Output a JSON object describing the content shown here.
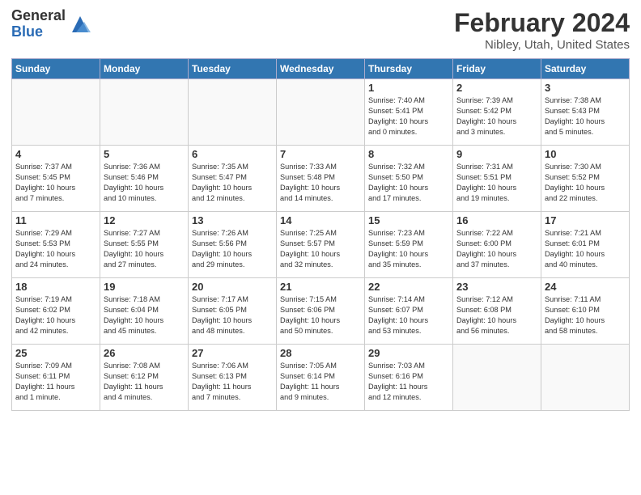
{
  "header": {
    "logo_general": "General",
    "logo_blue": "Blue",
    "main_title": "February 2024",
    "sub_title": "Nibley, Utah, United States"
  },
  "days_of_week": [
    "Sunday",
    "Monday",
    "Tuesday",
    "Wednesday",
    "Thursday",
    "Friday",
    "Saturday"
  ],
  "weeks": [
    {
      "days": [
        {
          "num": "",
          "info": ""
        },
        {
          "num": "",
          "info": ""
        },
        {
          "num": "",
          "info": ""
        },
        {
          "num": "",
          "info": ""
        },
        {
          "num": "1",
          "info": "Sunrise: 7:40 AM\nSunset: 5:41 PM\nDaylight: 10 hours\nand 0 minutes."
        },
        {
          "num": "2",
          "info": "Sunrise: 7:39 AM\nSunset: 5:42 PM\nDaylight: 10 hours\nand 3 minutes."
        },
        {
          "num": "3",
          "info": "Sunrise: 7:38 AM\nSunset: 5:43 PM\nDaylight: 10 hours\nand 5 minutes."
        }
      ]
    },
    {
      "days": [
        {
          "num": "4",
          "info": "Sunrise: 7:37 AM\nSunset: 5:45 PM\nDaylight: 10 hours\nand 7 minutes."
        },
        {
          "num": "5",
          "info": "Sunrise: 7:36 AM\nSunset: 5:46 PM\nDaylight: 10 hours\nand 10 minutes."
        },
        {
          "num": "6",
          "info": "Sunrise: 7:35 AM\nSunset: 5:47 PM\nDaylight: 10 hours\nand 12 minutes."
        },
        {
          "num": "7",
          "info": "Sunrise: 7:33 AM\nSunset: 5:48 PM\nDaylight: 10 hours\nand 14 minutes."
        },
        {
          "num": "8",
          "info": "Sunrise: 7:32 AM\nSunset: 5:50 PM\nDaylight: 10 hours\nand 17 minutes."
        },
        {
          "num": "9",
          "info": "Sunrise: 7:31 AM\nSunset: 5:51 PM\nDaylight: 10 hours\nand 19 minutes."
        },
        {
          "num": "10",
          "info": "Sunrise: 7:30 AM\nSunset: 5:52 PM\nDaylight: 10 hours\nand 22 minutes."
        }
      ]
    },
    {
      "days": [
        {
          "num": "11",
          "info": "Sunrise: 7:29 AM\nSunset: 5:53 PM\nDaylight: 10 hours\nand 24 minutes."
        },
        {
          "num": "12",
          "info": "Sunrise: 7:27 AM\nSunset: 5:55 PM\nDaylight: 10 hours\nand 27 minutes."
        },
        {
          "num": "13",
          "info": "Sunrise: 7:26 AM\nSunset: 5:56 PM\nDaylight: 10 hours\nand 29 minutes."
        },
        {
          "num": "14",
          "info": "Sunrise: 7:25 AM\nSunset: 5:57 PM\nDaylight: 10 hours\nand 32 minutes."
        },
        {
          "num": "15",
          "info": "Sunrise: 7:23 AM\nSunset: 5:59 PM\nDaylight: 10 hours\nand 35 minutes."
        },
        {
          "num": "16",
          "info": "Sunrise: 7:22 AM\nSunset: 6:00 PM\nDaylight: 10 hours\nand 37 minutes."
        },
        {
          "num": "17",
          "info": "Sunrise: 7:21 AM\nSunset: 6:01 PM\nDaylight: 10 hours\nand 40 minutes."
        }
      ]
    },
    {
      "days": [
        {
          "num": "18",
          "info": "Sunrise: 7:19 AM\nSunset: 6:02 PM\nDaylight: 10 hours\nand 42 minutes."
        },
        {
          "num": "19",
          "info": "Sunrise: 7:18 AM\nSunset: 6:04 PM\nDaylight: 10 hours\nand 45 minutes."
        },
        {
          "num": "20",
          "info": "Sunrise: 7:17 AM\nSunset: 6:05 PM\nDaylight: 10 hours\nand 48 minutes."
        },
        {
          "num": "21",
          "info": "Sunrise: 7:15 AM\nSunset: 6:06 PM\nDaylight: 10 hours\nand 50 minutes."
        },
        {
          "num": "22",
          "info": "Sunrise: 7:14 AM\nSunset: 6:07 PM\nDaylight: 10 hours\nand 53 minutes."
        },
        {
          "num": "23",
          "info": "Sunrise: 7:12 AM\nSunset: 6:08 PM\nDaylight: 10 hours\nand 56 minutes."
        },
        {
          "num": "24",
          "info": "Sunrise: 7:11 AM\nSunset: 6:10 PM\nDaylight: 10 hours\nand 58 minutes."
        }
      ]
    },
    {
      "days": [
        {
          "num": "25",
          "info": "Sunrise: 7:09 AM\nSunset: 6:11 PM\nDaylight: 11 hours\nand 1 minute."
        },
        {
          "num": "26",
          "info": "Sunrise: 7:08 AM\nSunset: 6:12 PM\nDaylight: 11 hours\nand 4 minutes."
        },
        {
          "num": "27",
          "info": "Sunrise: 7:06 AM\nSunset: 6:13 PM\nDaylight: 11 hours\nand 7 minutes."
        },
        {
          "num": "28",
          "info": "Sunrise: 7:05 AM\nSunset: 6:14 PM\nDaylight: 11 hours\nand 9 minutes."
        },
        {
          "num": "29",
          "info": "Sunrise: 7:03 AM\nSunset: 6:16 PM\nDaylight: 11 hours\nand 12 minutes."
        },
        {
          "num": "",
          "info": ""
        },
        {
          "num": "",
          "info": ""
        }
      ]
    }
  ]
}
